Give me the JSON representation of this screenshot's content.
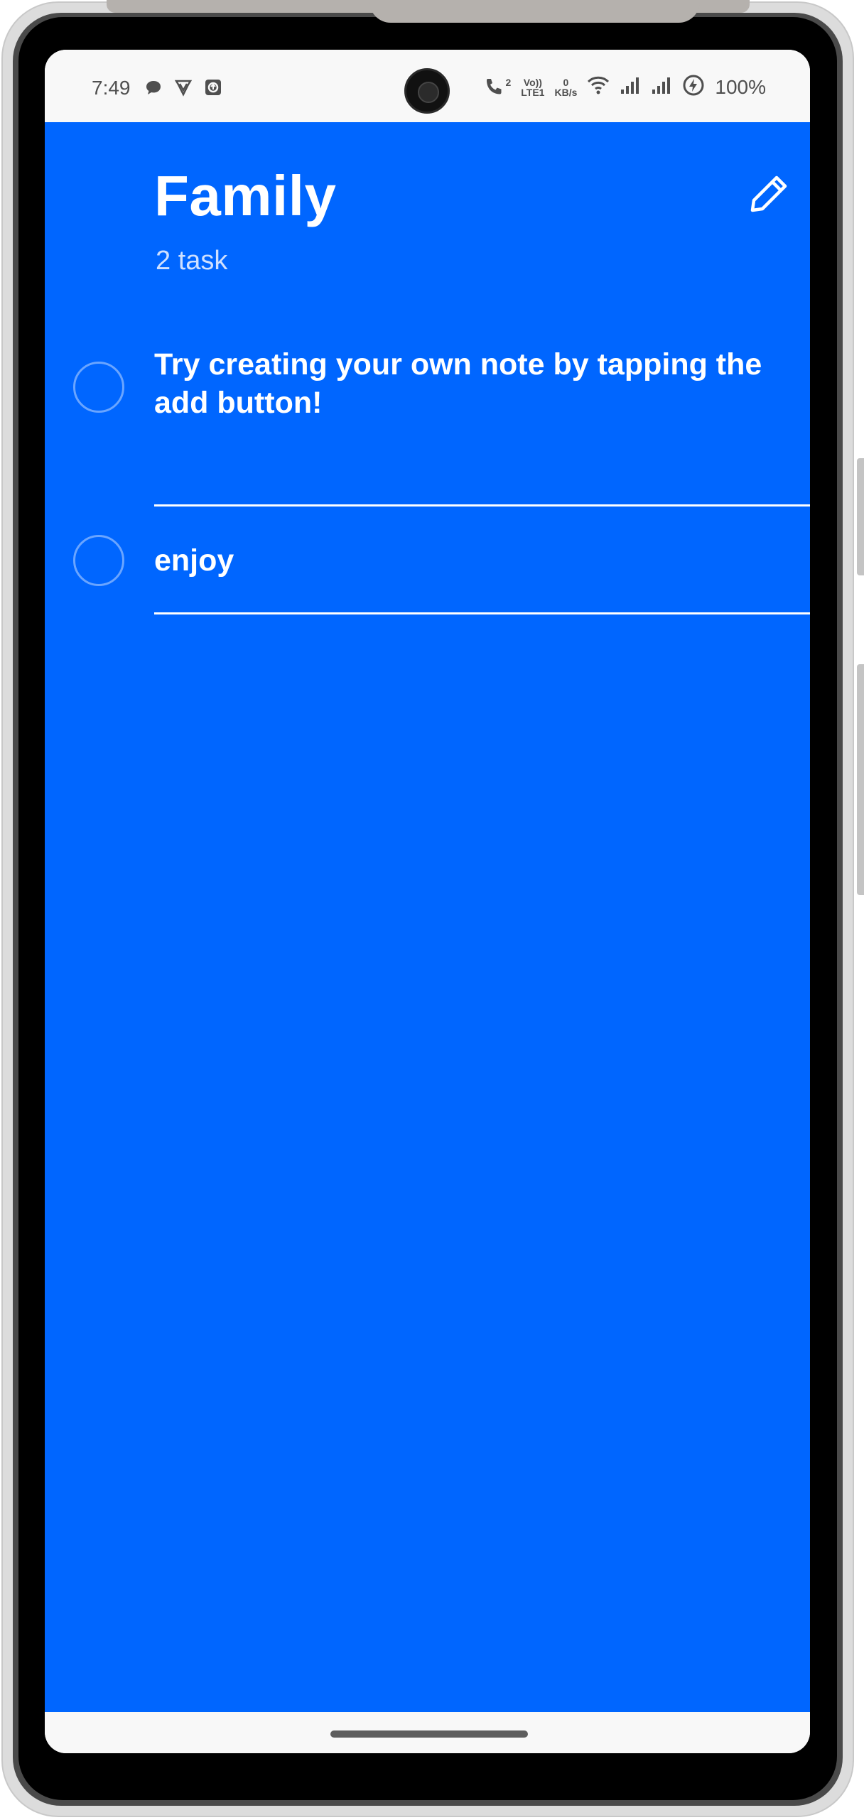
{
  "status_bar": {
    "time": "7:49",
    "left_icons": [
      "chat-bubble-icon",
      "shield-v-icon",
      "upload-square-icon"
    ],
    "right_icons": [
      "wifi-call-icon",
      "volte-icon",
      "data-speed-icon",
      "wifi-icon",
      "signal-1-icon",
      "signal-2-icon",
      "battery-charging-icon"
    ],
    "call_sup": "2",
    "volte_label_top": "Vo))",
    "volte_label_bottom": "LTE1",
    "data_speed_top": "0",
    "data_speed_bottom": "KB/s",
    "battery": "100%"
  },
  "header": {
    "title": "Family",
    "task_count": "2 task",
    "edit_icon": "pencil-icon"
  },
  "tasks": [
    {
      "text": "Try creating your own note by tapping the add button!",
      "completed": false
    },
    {
      "text": "enjoy",
      "completed": false
    }
  ],
  "colors": {
    "background": "#0066ff",
    "text": "#ffffff",
    "checkbox_border": "#6aa5ff",
    "status_bar": "#f8f8f8"
  }
}
